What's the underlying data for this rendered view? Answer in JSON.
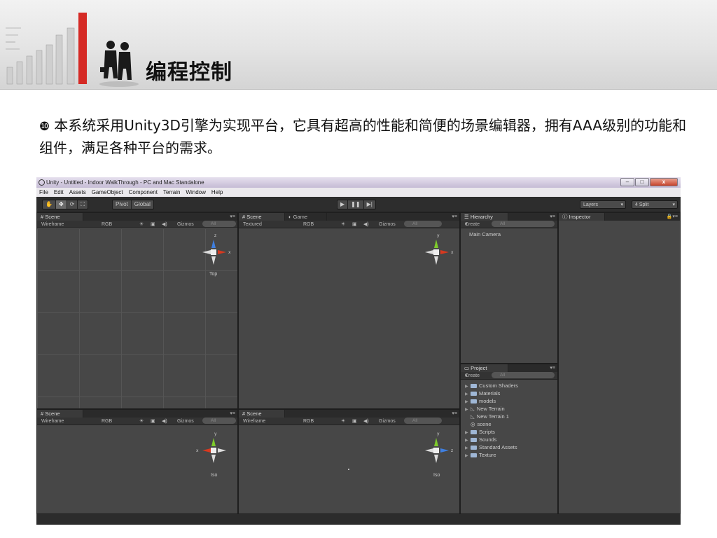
{
  "slide": {
    "title": "编程控制",
    "bullet_mark": "❿",
    "description": "本系统采用Unity3D引擎为实现平台，它具有超高的性能和简便的场景编辑器，拥有AAA级别的功能和组件，满足各种平台的需求。"
  },
  "window": {
    "title": "Unity - Untitled - Indoor WalkThrough - PC and Mac Standalone",
    "buttons": {
      "minimize": "–",
      "maximize": "□",
      "close": "x"
    }
  },
  "menu": [
    "File",
    "Edit",
    "Assets",
    "GameObject",
    "Component",
    "Terrain",
    "Window",
    "Help"
  ],
  "toolbar": {
    "tools": [
      "✋",
      "✥",
      "⟳",
      "⛶"
    ],
    "pivot": "Pivot",
    "global": "Global",
    "play": "▶",
    "pause": "❚❚",
    "step": "▶|",
    "layers": "Layers",
    "layout": "4 Split"
  },
  "scene_top": {
    "tab": "Scene",
    "render_mode": "Wireframe",
    "color_mode": "RGB",
    "gizmos": "Gizmos",
    "search_placeholder": "All",
    "axis_up": "z",
    "axis_side": "x",
    "view_label": "Top"
  },
  "scene_persp": {
    "tab": "Scene",
    "tab2": "Game",
    "render_mode": "Textured",
    "color_mode": "RGB",
    "gizmos": "Gizmos",
    "search_placeholder": "All",
    "axis_up": "y",
    "axis_side": "x"
  },
  "scene_iso_left": {
    "tab": "Scene",
    "render_mode": "Wireframe",
    "color_mode": "RGB",
    "gizmos": "Gizmos",
    "search_placeholder": "All",
    "axis_up": "y",
    "axis_side": "x",
    "view_label": "Iso"
  },
  "scene_iso_right": {
    "tab": "Scene",
    "render_mode": "Wireframe",
    "color_mode": "RGB",
    "gizmos": "Gizmos",
    "search_placeholder": "All",
    "axis_up": "y",
    "axis_side": "z",
    "view_label": "Iso"
  },
  "hierarchy": {
    "tab": "Hierarchy",
    "create": "Create",
    "search_placeholder": "All",
    "items": [
      "Main Camera"
    ]
  },
  "project": {
    "tab": "Project",
    "create": "Create",
    "search_placeholder": "All",
    "items": [
      {
        "name": "Custom Shaders",
        "icon": "folder-icon"
      },
      {
        "name": "Materials",
        "icon": "folder-icon"
      },
      {
        "name": "models",
        "icon": "folder-icon"
      },
      {
        "name": "New Terrain",
        "icon": "terrain-icon"
      },
      {
        "name": "New Terrain 1",
        "icon": "terrain-icon"
      },
      {
        "name": "scene",
        "icon": "unity-scene-icon"
      },
      {
        "name": "Scripts",
        "icon": "folder-icon"
      },
      {
        "name": "Sounds",
        "icon": "folder-icon"
      },
      {
        "name": "Standard Assets",
        "icon": "folder-icon"
      },
      {
        "name": "Texture",
        "icon": "folder-icon"
      }
    ]
  },
  "inspector": {
    "tab": "Inspector"
  },
  "colors": {
    "axis_x": "#d8391f",
    "axis_y": "#7ecb2a",
    "axis_z": "#3f7fe0",
    "editor_bg": "#474747"
  }
}
